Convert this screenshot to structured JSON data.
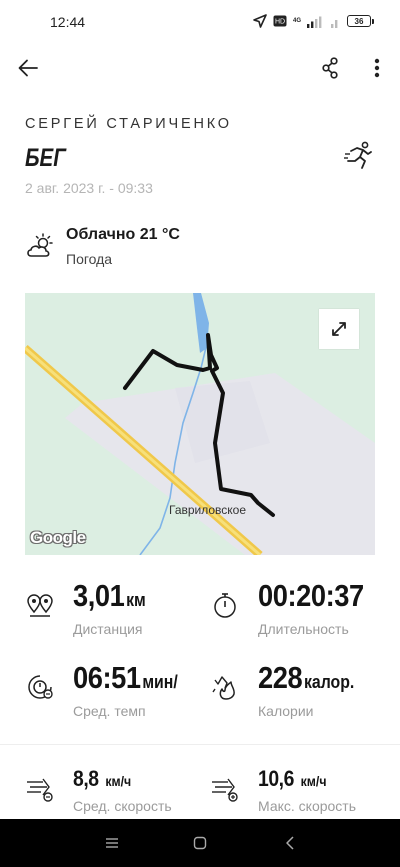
{
  "status_bar": {
    "time": "12:44",
    "network_label": "4G",
    "battery_level": "36"
  },
  "toolbar": {
    "back_icon": "arrow-left-icon",
    "share_icon": "share-icon",
    "more_icon": "more-vertical-icon"
  },
  "activity": {
    "user_name": "СЕРГЕЙ СТАРИЧЕНКО",
    "type": "БЕГ",
    "date": "2 авг. 2023 г. - 09:33",
    "type_icon": "running-person-icon"
  },
  "weather": {
    "condition": "Облачно 21 °C",
    "label": "Погода",
    "icon": "partly-cloudy-icon"
  },
  "map": {
    "place_label": "Гавриловское",
    "logo_text": "Google",
    "expand_icon": "expand-arrows-icon",
    "colors": {
      "land": "#dceee2",
      "built_area": "#e8e8ee",
      "road": "#f3d35b",
      "water": "#7fb4e8",
      "route": "#111111"
    }
  },
  "stats": {
    "distance": {
      "value": "3,01",
      "unit": "км",
      "label": "Дистанция",
      "icon": "distance-pins-icon"
    },
    "duration": {
      "value": "00:20:37",
      "unit": "",
      "label": "Длительность",
      "icon": "stopwatch-icon"
    },
    "avg_pace": {
      "value": "06:51",
      "unit": "мин/",
      "label": "Сред. темп",
      "icon": "pace-clock-icon"
    },
    "calories": {
      "value": "228",
      "unit": "калор.",
      "label": "Калории",
      "icon": "calories-flame-icon"
    },
    "avg_speed": {
      "value": "8,8",
      "unit": "км/ч",
      "label": "Сред. скорость",
      "icon": "speed-average-icon"
    },
    "max_speed": {
      "value": "10,6",
      "unit": "км/ч",
      "label": "Макс. скорость",
      "icon": "speed-max-icon"
    }
  },
  "nav_bar": {
    "menu_icon": "menu-lines-icon",
    "home_icon": "home-square-icon",
    "back_icon": "nav-back-icon"
  }
}
